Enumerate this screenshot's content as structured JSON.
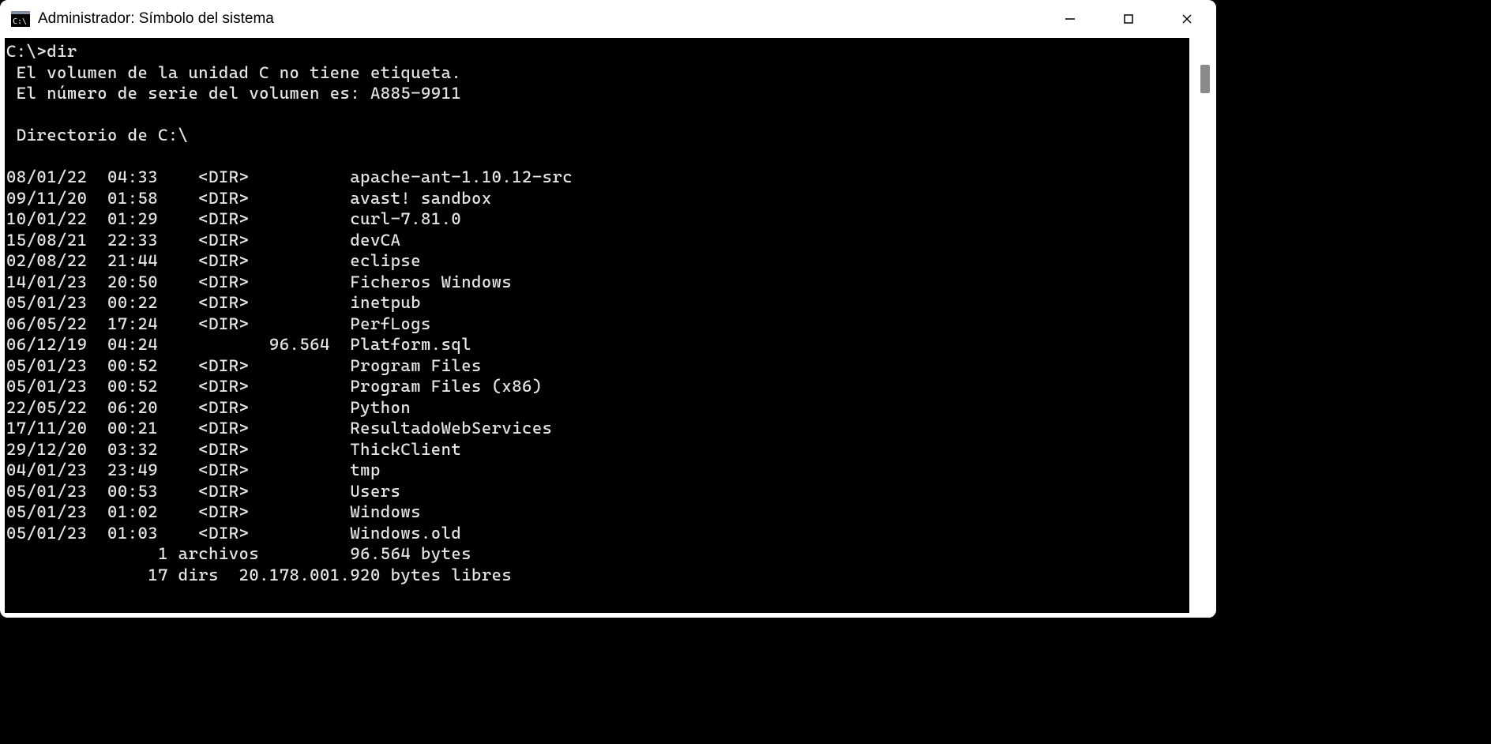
{
  "titlebar": {
    "title": "Administrador: Símbolo del sistema"
  },
  "terminal": {
    "prompt": "C:\\>",
    "command": "dir",
    "volume_line": " El volumen de la unidad C no tiene etiqueta.",
    "serial_line": " El número de serie del volumen es: A885-9911",
    "directory_line": " Directorio de C:\\",
    "entries": [
      {
        "date": "08/01/22",
        "time": "04:33",
        "type": "<DIR>",
        "size": "",
        "name": "apache-ant-1.10.12-src"
      },
      {
        "date": "09/11/20",
        "time": "01:58",
        "type": "<DIR>",
        "size": "",
        "name": "avast! sandbox"
      },
      {
        "date": "10/01/22",
        "time": "01:29",
        "type": "<DIR>",
        "size": "",
        "name": "curl-7.81.0"
      },
      {
        "date": "15/08/21",
        "time": "22:33",
        "type": "<DIR>",
        "size": "",
        "name": "devCA"
      },
      {
        "date": "02/08/22",
        "time": "21:44",
        "type": "<DIR>",
        "size": "",
        "name": "eclipse"
      },
      {
        "date": "14/01/23",
        "time": "20:50",
        "type": "<DIR>",
        "size": "",
        "name": "Ficheros Windows"
      },
      {
        "date": "05/01/23",
        "time": "00:22",
        "type": "<DIR>",
        "size": "",
        "name": "inetpub"
      },
      {
        "date": "06/05/22",
        "time": "17:24",
        "type": "<DIR>",
        "size": "",
        "name": "PerfLogs"
      },
      {
        "date": "06/12/19",
        "time": "04:24",
        "type": "",
        "size": "96.564",
        "name": "Platform.sql"
      },
      {
        "date": "05/01/23",
        "time": "00:52",
        "type": "<DIR>",
        "size": "",
        "name": "Program Files"
      },
      {
        "date": "05/01/23",
        "time": "00:52",
        "type": "<DIR>",
        "size": "",
        "name": "Program Files (x86)"
      },
      {
        "date": "22/05/22",
        "time": "06:20",
        "type": "<DIR>",
        "size": "",
        "name": "Python"
      },
      {
        "date": "17/11/20",
        "time": "00:21",
        "type": "<DIR>",
        "size": "",
        "name": "ResultadoWebServices"
      },
      {
        "date": "29/12/20",
        "time": "03:32",
        "type": "<DIR>",
        "size": "",
        "name": "ThickClient"
      },
      {
        "date": "04/01/23",
        "time": "23:49",
        "type": "<DIR>",
        "size": "",
        "name": "tmp"
      },
      {
        "date": "05/01/23",
        "time": "00:53",
        "type": "<DIR>",
        "size": "",
        "name": "Users"
      },
      {
        "date": "05/01/23",
        "time": "01:02",
        "type": "<DIR>",
        "size": "",
        "name": "Windows"
      },
      {
        "date": "05/01/23",
        "time": "01:03",
        "type": "<DIR>",
        "size": "",
        "name": "Windows.old"
      }
    ],
    "summary_files": "               1 archivos         96.564 bytes",
    "summary_dirs": "              17 dirs  20.178.001.920 bytes libres"
  }
}
